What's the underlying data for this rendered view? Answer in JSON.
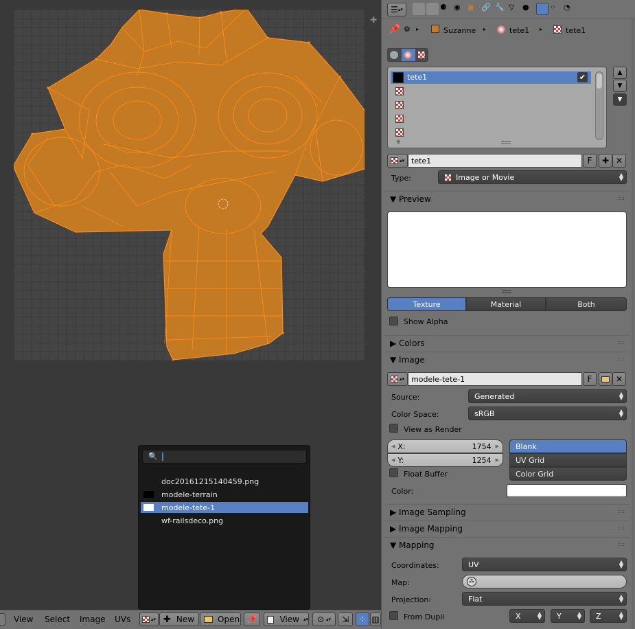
{
  "uv_editor": {
    "header_menus": [
      "View",
      "Select",
      "Image",
      "UVs"
    ],
    "new_label": "New",
    "open_label": "Open",
    "view_label": "View"
  },
  "image_popup": {
    "search_value": "",
    "items": [
      {
        "label": "doc20161215140459.png",
        "thumb": "none",
        "selected": false
      },
      {
        "label": "modele-terrain",
        "thumb": "#000000",
        "selected": false
      },
      {
        "label": "modele-tete-1",
        "thumb": "#ffffff",
        "selected": true
      },
      {
        "label": "wf-railsdeco.png",
        "thumb": "none",
        "selected": false
      }
    ]
  },
  "properties": {
    "breadcrumb": {
      "object": "Suzanne",
      "material": "tete1",
      "texture": "tete1"
    },
    "texture_slots": [
      {
        "label": "tete1",
        "active": true,
        "checked": true
      },
      {
        "label": ""
      },
      {
        "label": ""
      },
      {
        "label": ""
      },
      {
        "label": ""
      }
    ],
    "texture_name": "tete1",
    "fake_user": "F",
    "type_label": "Type:",
    "type_value": "Image or Movie",
    "preview": {
      "title": "Preview",
      "tabs": [
        "Texture",
        "Material",
        "Both"
      ],
      "active_tab": "Texture",
      "show_alpha": "Show Alpha"
    },
    "colors_panel": "Colors",
    "image_panel": {
      "title": "Image",
      "image_name": "modele-tete-1",
      "fake_user": "F",
      "source_label": "Source:",
      "source_value": "Generated",
      "colorspace_label": "Color Space:",
      "colorspace_value": "sRGB",
      "view_as_render": "View as Render",
      "x_label": "X:",
      "x_value": "1754",
      "y_label": "Y:",
      "y_value": "1254",
      "gen_types": [
        "Blank",
        "UV Grid",
        "Color Grid"
      ],
      "gen_selected": "Blank",
      "float_buffer": "Float Buffer",
      "color_label": "Color:"
    },
    "image_sampling": "Image Sampling",
    "image_mapping": "Image Mapping",
    "mapping_panel": {
      "title": "Mapping",
      "coordinates_label": "Coordinates:",
      "coordinates_value": "UV",
      "map_label": "Map:",
      "projection_label": "Projection:",
      "projection_value": "Flat",
      "from_dupli": "From Dupli",
      "axes": [
        "X",
        "Y",
        "Z"
      ]
    }
  },
  "colors": {
    "accent": "#5680c2",
    "mesh_fill": "#c37a22",
    "mesh_edge": "#ff8c1a",
    "panel_bg": "#727272",
    "editor_bg": "#393939"
  }
}
